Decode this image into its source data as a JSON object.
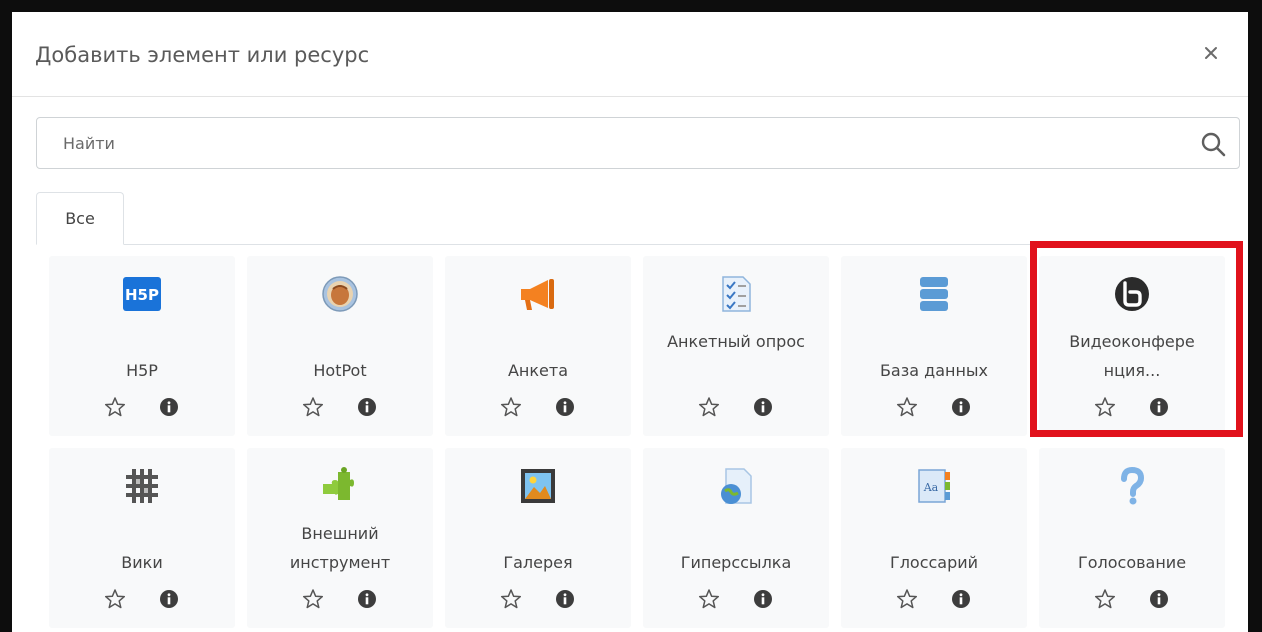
{
  "modal": {
    "title": "Добавить элемент или ресурс",
    "close_label": "×"
  },
  "search": {
    "placeholder": "Найти",
    "value": ""
  },
  "tabs": [
    {
      "label": "Все",
      "active": true
    }
  ],
  "items": [
    {
      "id": "h5p",
      "label": "H5P",
      "icon": "h5p-icon"
    },
    {
      "id": "hotpot",
      "label": "HotPot",
      "icon": "hotpot-icon"
    },
    {
      "id": "anketa",
      "label": "Анкета",
      "icon": "megaphone-icon"
    },
    {
      "id": "anketnyj-opros",
      "label": "Анкетный опрос",
      "icon": "survey-checklist-icon"
    },
    {
      "id": "baza-dannyh",
      "label": "База данных",
      "icon": "database-icon"
    },
    {
      "id": "videokonferenciya",
      "label": "Видеоконфере нция...",
      "icon": "bigbluebutton-icon"
    },
    {
      "id": "viki",
      "label": "Вики",
      "icon": "wiki-icon"
    },
    {
      "id": "vneshnij-instrument",
      "label": "Внешний инструмент",
      "icon": "puzzle-icon"
    },
    {
      "id": "galereya",
      "label": "Галерея",
      "icon": "gallery-image-icon"
    },
    {
      "id": "giperssylka",
      "label": "Гиперссылка",
      "icon": "url-globe-icon"
    },
    {
      "id": "glossarij",
      "label": "Глоссарий",
      "icon": "glossary-icon"
    },
    {
      "id": "golosovanie",
      "label": "Голосование",
      "icon": "question-mark-icon"
    }
  ],
  "highlighted_item": "videokonferenciya",
  "colors": {
    "highlight_border": "#e1121c",
    "card_background": "#f8f9fa",
    "h5p_brand": "#1a73d9",
    "icon_orange": "#f48120",
    "icon_blue": "#5b9bd5",
    "icon_green": "#7cb82f"
  }
}
